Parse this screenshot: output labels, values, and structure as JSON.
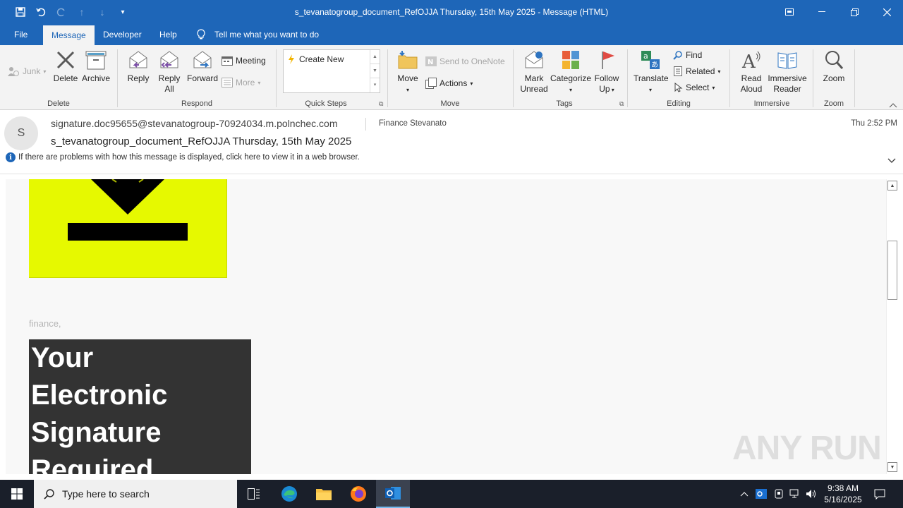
{
  "window": {
    "title": "s_tevanatogroup_document_RefOJJA Thursday, 15th May 2025  -  Message (HTML)"
  },
  "menu": {
    "tabs": [
      "File",
      "Message",
      "Developer",
      "Help"
    ],
    "tell_me": "Tell me what you want to do"
  },
  "ribbon": {
    "delete_group": {
      "junk": "Junk",
      "delete": "Delete",
      "archive": "Archive",
      "label": "Delete"
    },
    "respond_group": {
      "reply": "Reply",
      "reply_all_1": "Reply",
      "reply_all_2": "All",
      "forward": "Forward",
      "meeting": "Meeting",
      "more": "More",
      "label": "Respond"
    },
    "quick_steps": {
      "create_new": "Create New",
      "label": "Quick Steps"
    },
    "move_group": {
      "move": "Move",
      "send_onenote": "Send to OneNote",
      "actions": "Actions",
      "label": "Move"
    },
    "tags_group": {
      "mark_1": "Mark",
      "mark_2": "Unread",
      "categorize": "Categorize",
      "follow_1": "Follow",
      "follow_2": "Up",
      "label": "Tags"
    },
    "editing_group": {
      "translate": "Translate",
      "find": "Find",
      "related": "Related",
      "select": "Select",
      "label": "Editing"
    },
    "immersive_group": {
      "read_1": "Read",
      "read_2": "Aloud",
      "reader_1": "Immersive",
      "reader_2": "Reader",
      "label": "Immersive"
    },
    "zoom_group": {
      "zoom": "Zoom",
      "label": "Zoom"
    }
  },
  "message": {
    "avatar_initial": "S",
    "from": "signature.doc95655@stevanatogroup-70924034.m.polnchec.com",
    "to": "Finance Stevanato",
    "time": "Thu 2:52 PM",
    "subject": "s_tevanatogroup_document_RefOJJA Thursday, 15th May 2025",
    "info_bar": "If there are problems with how this message is displayed, click here to view it in a web browser."
  },
  "body": {
    "greeting": "finance,",
    "banner_lines": [
      "Your",
      "Electronic",
      "Signature",
      "Required"
    ]
  },
  "watermark": "ANY RUN",
  "taskbar": {
    "search_placeholder": "Type here to search",
    "time": "9:38 AM",
    "date": "5/16/2025"
  },
  "colors": {
    "brand_blue": "#1e66b8",
    "banner_yellow": "#e6f900",
    "banner_dark": "#333333"
  }
}
